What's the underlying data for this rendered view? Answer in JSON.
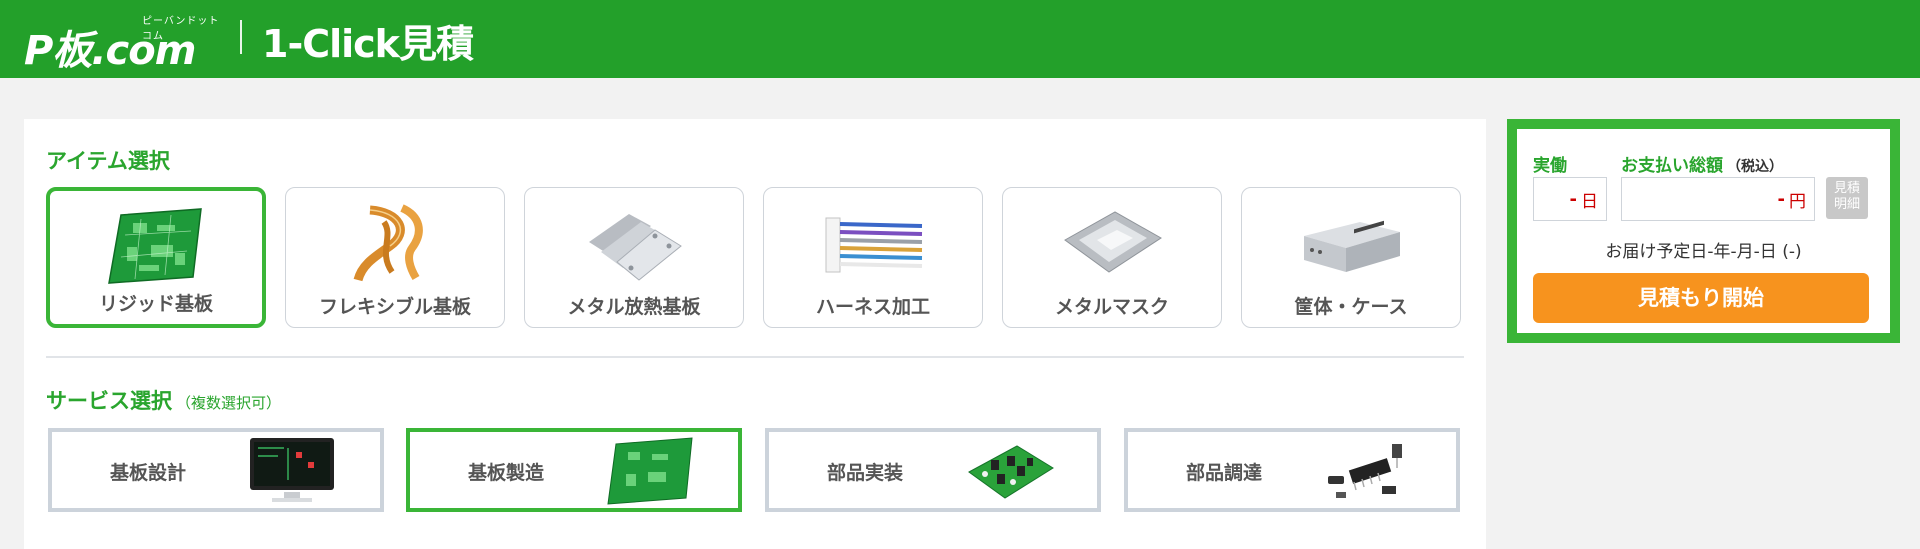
{
  "header": {
    "logo_text": "P板.com",
    "logo_ruby": "ピーバンドットコム",
    "app_title": "1-Click見積"
  },
  "items_section": {
    "title": "アイテム選択",
    "items": [
      {
        "label": "リジッド基板",
        "icon": "rigid-pcb-image",
        "selected": true
      },
      {
        "label": "フレキシブル基板",
        "icon": "flex-pcb-image",
        "selected": false
      },
      {
        "label": "メタル放熱基板",
        "icon": "metal-pcb-image",
        "selected": false
      },
      {
        "label": "ハーネス加工",
        "icon": "harness-image",
        "selected": false
      },
      {
        "label": "メタルマスク",
        "icon": "metal-mask-image",
        "selected": false
      },
      {
        "label": "筐体・ケース",
        "icon": "enclosure-image",
        "selected": false
      }
    ]
  },
  "services_section": {
    "title": "サービス選択",
    "subtitle": "（複数選択可）",
    "items": [
      {
        "label": "基板設計",
        "icon": "design-monitor-image",
        "selected": false
      },
      {
        "label": "基板製造",
        "icon": "pcb-board-image",
        "selected": true
      },
      {
        "label": "部品実装",
        "icon": "assembled-pcb-image",
        "selected": false
      },
      {
        "label": "部品調達",
        "icon": "components-image",
        "selected": false
      }
    ]
  },
  "quote_panel": {
    "work_days_label": "実働",
    "work_days_value": "-",
    "work_days_unit": "日",
    "total_label": "お支払い総額",
    "total_tax_note": "（税込）",
    "total_value": "-",
    "total_unit": "円",
    "detail_button_line1": "見積",
    "detail_button_line2": "明細",
    "delivery_text": "お届け予定日-年-月-日 (-)",
    "start_button": "見積もり開始"
  },
  "colors": {
    "brand_green": "#23a02a",
    "selected_border": "#3ab537",
    "start_orange": "#f7931e"
  }
}
